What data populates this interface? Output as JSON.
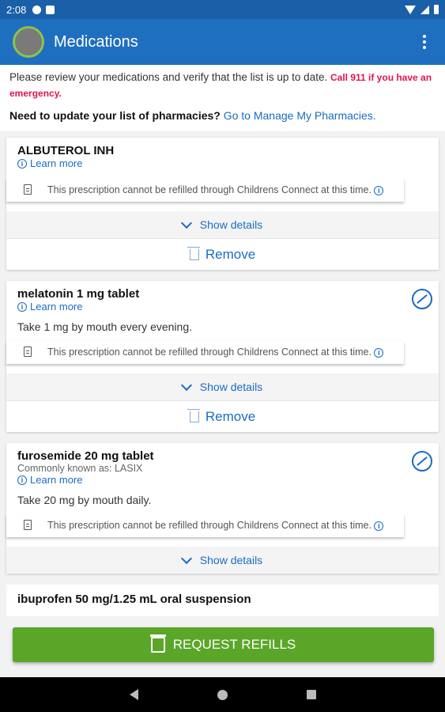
{
  "status_bar": {
    "time": "2:08"
  },
  "app_bar": {
    "title": "Medications"
  },
  "intro": {
    "text": "Please review your medications and verify that the list is up to date.",
    "emergency": "Call 911 if you have an emergency."
  },
  "pharmacy": {
    "question": "Need to update your list of pharmacies?",
    "link": "Go to Manage My Pharmacies."
  },
  "notice_text": "This prescription cannot be refilled through Childrens Connect at this time.",
  "learn_more": "Learn more",
  "show_details": "Show details",
  "remove": "Remove",
  "medications": [
    {
      "name": "ALBUTEROL INH"
    },
    {
      "name": "melatonin 1 mg tablet",
      "instructions": "Take 1 mg by mouth every evening."
    },
    {
      "name": "furosemide 20 mg tablet",
      "aka": "Commonly known as: LASIX",
      "instructions": "Take 20 mg by mouth daily."
    },
    {
      "name": "ibuprofen 50 mg/1.25 mL oral suspension"
    }
  ],
  "request_refills": "REQUEST REFILLS",
  "icons": [
    "avatar",
    "more-vert-icon",
    "info-icon",
    "document-icon",
    "chevron-down-icon",
    "trash-icon",
    "no-entry-icon",
    "prescription-icon",
    "back-icon",
    "home-icon",
    "recents-icon"
  ]
}
